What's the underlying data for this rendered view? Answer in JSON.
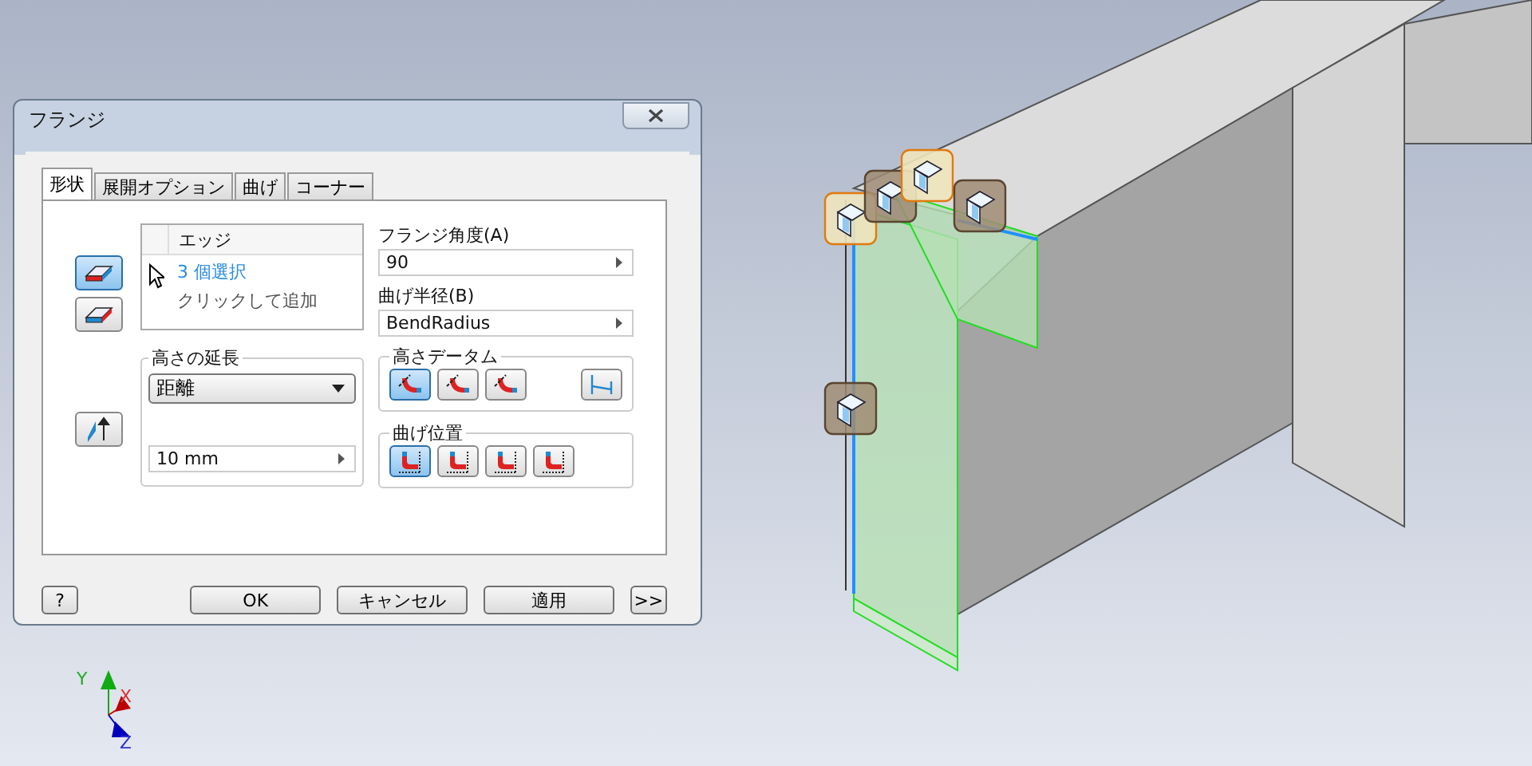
{
  "dialog": {
    "title": "フランジ",
    "tabs": [
      {
        "label": "形状",
        "selected": true
      },
      {
        "label": "展開オプション",
        "selected": false
      },
      {
        "label": "曲げ",
        "selected": false
      },
      {
        "label": "コーナー",
        "selected": false
      }
    ],
    "selection_buttons": [
      {
        "selected": true
      },
      {
        "selected": false
      }
    ],
    "edge_list": {
      "header": "エッジ",
      "rows": [
        {
          "text": "3 個選択",
          "selected": true
        },
        {
          "text": "クリックして追加",
          "selected": false
        }
      ]
    },
    "height_extent": {
      "legend": "高さの延長",
      "dropdown": "距離",
      "value": "10 mm"
    },
    "flange_angle": {
      "label": "フランジ角度(A)",
      "value": "90"
    },
    "bend_radius": {
      "label": "曲げ半径(B)",
      "value": "BendRadius"
    },
    "height_datum": {
      "legend": "高さデータム",
      "options": [
        {
          "selected": true
        },
        {
          "selected": false
        },
        {
          "selected": false
        },
        {
          "selected": false
        }
      ]
    },
    "bend_position": {
      "legend": "曲げ位置",
      "options": [
        {
          "selected": true
        },
        {
          "selected": false
        },
        {
          "selected": false
        },
        {
          "selected": false
        }
      ]
    },
    "buttons": [
      {
        "kind": "help",
        "label": "?"
      },
      {
        "kind": "text",
        "label": "OK"
      },
      {
        "kind": "text",
        "label": "キャンセル"
      },
      {
        "kind": "text",
        "label": "適用"
      },
      {
        "kind": "more",
        "label": ">>"
      }
    ]
  },
  "axes": {
    "x": "X",
    "y": "Y",
    "z": "Z"
  }
}
